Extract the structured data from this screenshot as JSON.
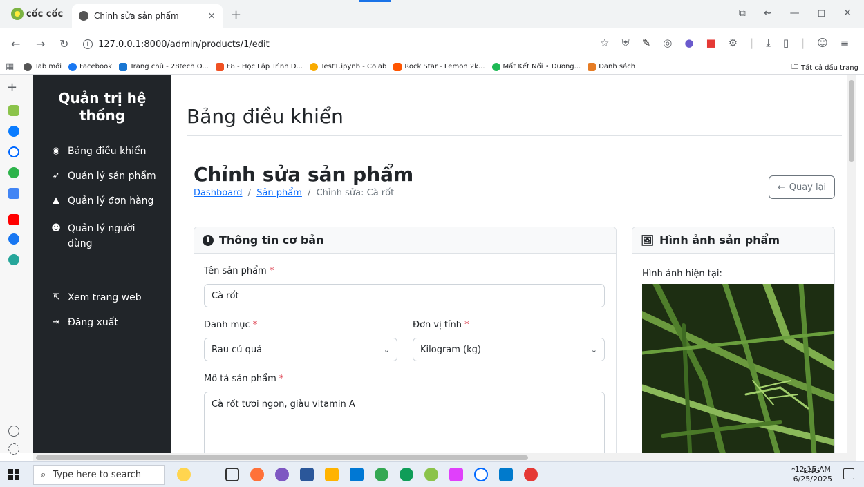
{
  "browser": {
    "brand": "cốc cốc",
    "tab_title": "Chỉnh sửa sản phẩm",
    "tab_close": "×",
    "new_tab": "+",
    "url": "127.0.0.1:8000/admin/products/1/edit",
    "bookmarks": [
      {
        "label": "Tab mới",
        "color": "#555555"
      },
      {
        "label": "Facebook",
        "color": "#1877f2"
      },
      {
        "label": "Trang chủ - 28tech O...",
        "color": "#1976d2"
      },
      {
        "label": "F8 - Học Lập Trình Đ...",
        "color": "#f05123"
      },
      {
        "label": "Test1.ipynb - Colab",
        "color": "#f9ab00"
      },
      {
        "label": "Rock Star - Lemon 2k...",
        "color": "#ff5500"
      },
      {
        "label": "Mất Kết Nối • Dương...",
        "color": "#1db954"
      },
      {
        "label": "Danh sách",
        "color": "#e67c24"
      }
    ],
    "all_bookmarks": "Tất cả dấu trang"
  },
  "admin": {
    "title": "Quản trị hệ thống",
    "nav": {
      "dashboard": "Bảng điều khiển",
      "products": "Quản lý sản phẩm",
      "orders": "Quản lý đơn hàng",
      "users": "Quản lý người dùng",
      "view_site": "Xem trang web",
      "logout": "Đăng xuất"
    }
  },
  "page": {
    "header": "Bảng điều khiển",
    "title": "Chỉnh sửa sản phẩm",
    "breadcrumb": {
      "dashboard": "Dashboard",
      "products": "Sản phẩm",
      "current": "Chỉnh sửa: Cà rốt",
      "sep": "/"
    },
    "back_button": "Quay lại"
  },
  "basic_info": {
    "header": "Thông tin cơ bản",
    "name_label": "Tên sản phẩm",
    "name_value": "Cà rốt",
    "category_label": "Danh mục",
    "category_value": "Rau củ quả",
    "unit_label": "Đơn vị tính",
    "unit_value": "Kilogram (kg)",
    "description_label": "Mô tả sản phẩm",
    "description_value": "Cà rốt tươi ngon, giàu vitamin A",
    "required_mark": "*"
  },
  "image_card": {
    "header": "Hình ảnh sản phẩm",
    "current_label": "Hình ảnh hiện tại:"
  },
  "taskbar": {
    "search_placeholder": "Type here to search",
    "language": "ENG",
    "time": "12:15 AM",
    "date": "6/25/2025"
  }
}
